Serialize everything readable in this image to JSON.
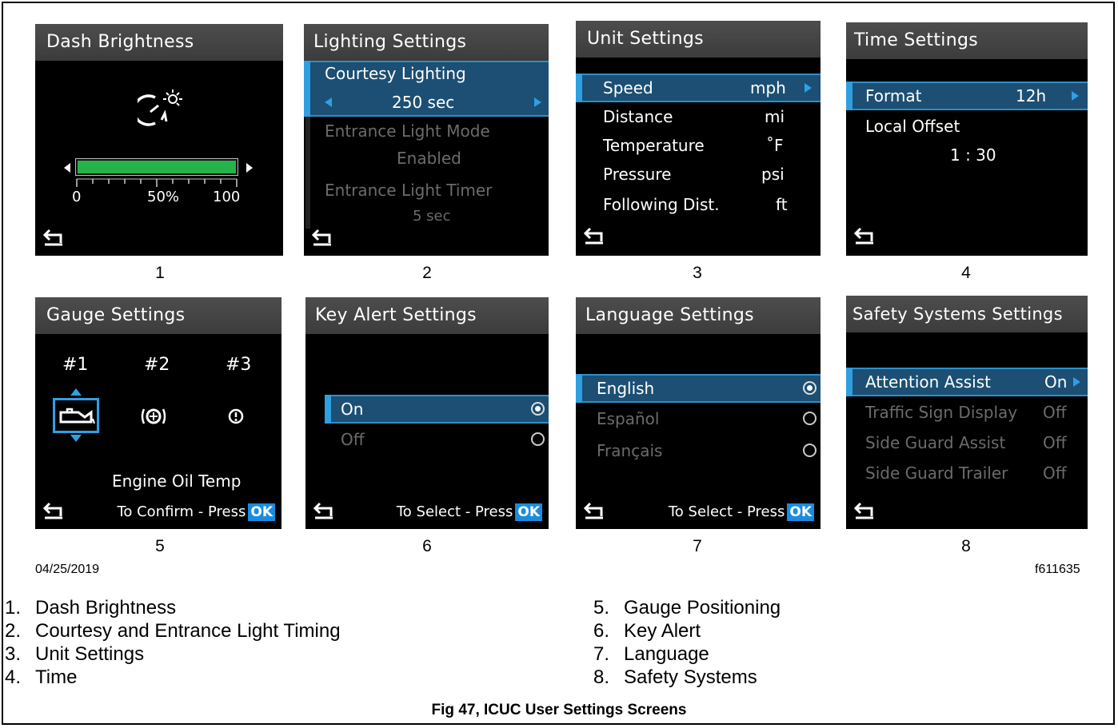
{
  "screens": {
    "s1": {
      "title": "Dash Brightness",
      "tick_0": "0",
      "tick_50": "50%",
      "tick_100": "100",
      "level": 1.0,
      "num": "1"
    },
    "s2": {
      "title": "Lighting Settings",
      "item1": "Courtesy Lighting",
      "value1": "250 sec",
      "item2": "Entrance Light Mode",
      "value2": "Enabled",
      "item3": "Entrance Light Timer",
      "value3": "5 sec",
      "num": "2"
    },
    "s3": {
      "title": "Unit Settings",
      "rows": [
        {
          "label": "Speed",
          "value": "mph"
        },
        {
          "label": "Distance",
          "value": "mi"
        },
        {
          "label": "Temperature",
          "value": "˚F"
        },
        {
          "label": "Pressure",
          "value": "psi"
        },
        {
          "label": "Following Dist.",
          "value": "ft"
        }
      ],
      "num": "3"
    },
    "s4": {
      "title": "Time Settings",
      "format_label": "Format",
      "format_value": "12h",
      "offset_label": "Local Offset",
      "offset_value": "1 : 30",
      "num": "4"
    },
    "s5": {
      "title": "Gauge Settings",
      "g1": "#1",
      "g2": "#2",
      "g3": "#3",
      "caption": "Engine Oil Temp",
      "prompt": "To Confirm - Press",
      "ok": "OK",
      "num": "5"
    },
    "s6": {
      "title": "Key Alert Settings",
      "opt1": "On",
      "opt2": "Off",
      "prompt": "To Select - Press",
      "ok": "OK",
      "num": "6"
    },
    "s7": {
      "title": "Language Settings",
      "opt1": "English",
      "opt2": "Español",
      "opt3": "Français",
      "prompt": "To Select - Press",
      "ok": "OK",
      "num": "7"
    },
    "s8": {
      "title": "Safety Systems Settings",
      "rows": [
        {
          "label": "Attention Assist",
          "value": "On"
        },
        {
          "label": "Traffic Sign Display",
          "value": "Off"
        },
        {
          "label": "Side Guard Assist",
          "value": "Off"
        },
        {
          "label": "Side Guard Trailer",
          "value": "Off"
        }
      ],
      "num": "8"
    }
  },
  "date": "04/25/2019",
  "figure_id": "f611635",
  "legend_left": [
    {
      "n": "1.",
      "t": "Dash Brightness"
    },
    {
      "n": "2.",
      "t": "Courtesy and Entrance Light Timing"
    },
    {
      "n": "3.",
      "t": "Unit Settings"
    },
    {
      "n": "4.",
      "t": "Time"
    }
  ],
  "legend_right": [
    {
      "n": "5.",
      "t": "Gauge Positioning"
    },
    {
      "n": "6.",
      "t": "Key Alert"
    },
    {
      "n": "7.",
      "t": "Language"
    },
    {
      "n": "8.",
      "t": "Safety Systems"
    }
  ],
  "caption": "Fig 47, ICUC User Settings Screens",
  "colors": {
    "highlight": "#1c4f73",
    "accent": "#2e9fe0",
    "ok": "#1a8ce0",
    "bar": "#27b34a"
  }
}
